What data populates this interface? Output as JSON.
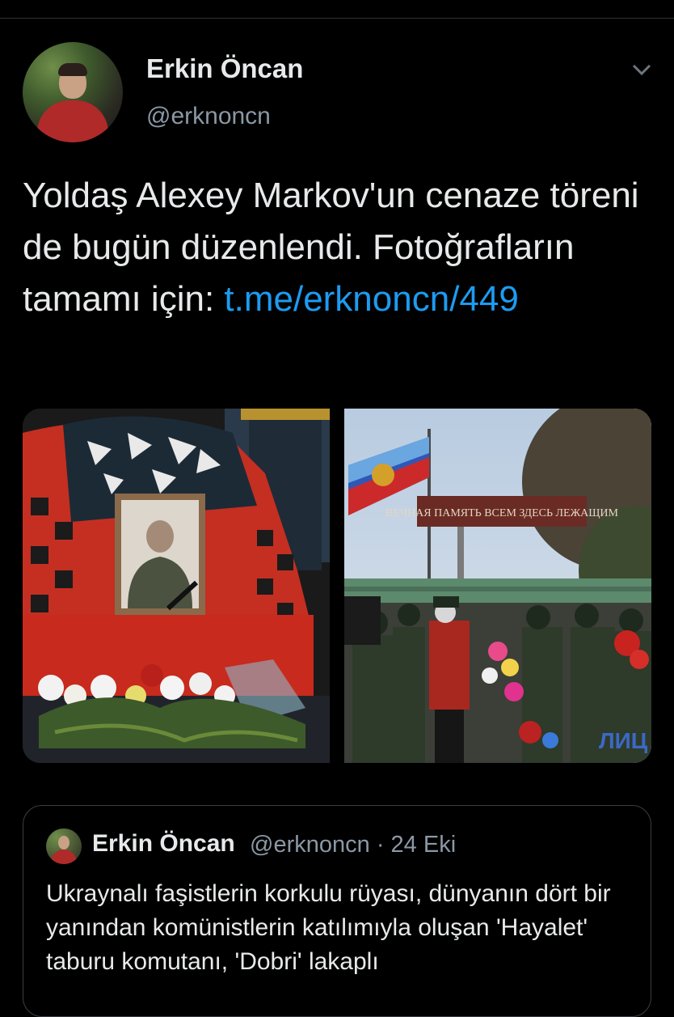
{
  "author": {
    "name": "Erkin Öncan",
    "handle": "@erknoncn"
  },
  "tweet": {
    "text_part1": "Yoldaş Alexey Markov'un cenaze töreni de bugün düzenlendi. Fotoğrafların tamamı için: ",
    "link_text": "t.me/erknoncn/449"
  },
  "media": {
    "photo1_label": "",
    "photo2_banner_text": "ВЕЧНАЯ ПАМЯТЬ ВСЕМ ЗДЕСЬ ЛЕЖАЩИМ",
    "photo2_watermark": "ЛИЦ"
  },
  "quoted_tweet": {
    "name": "Erkin Öncan",
    "handle": "@erknoncn",
    "separator": "·",
    "date": "24 Eki",
    "text": "Ukraynalı faşistlerin korkulu rüyası, dünyanın dört bir yanından komünistlerin katılımıyla oluşan 'Hayalet' taburu komutanı, 'Dobri' lakaplı"
  },
  "icons": {
    "caret": "chevron-down-icon"
  },
  "colors": {
    "background": "#000000",
    "text": "#e7e9ea",
    "secondary": "#8b98a5",
    "link": "#1d9bf0"
  }
}
